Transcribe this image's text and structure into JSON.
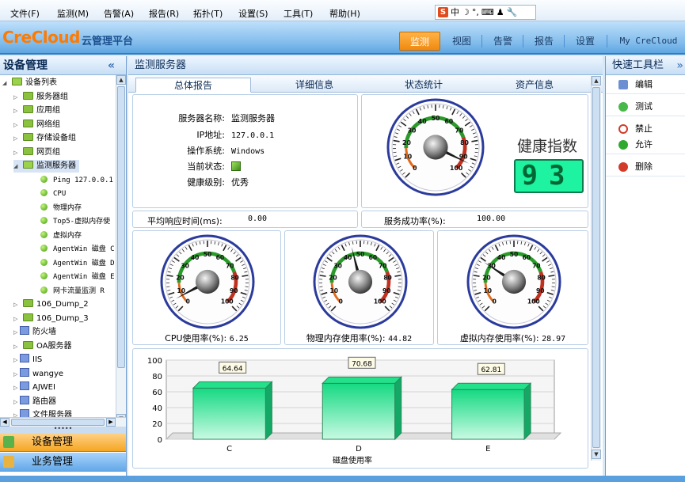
{
  "menubar": {
    "items": [
      "文件(F)",
      "监测(M)",
      "告警(A)",
      "报告(R)",
      "拓扑(T)",
      "设置(S)",
      "工具(T)",
      "帮助(H)"
    ],
    "ime": {
      "logo": "S",
      "mode": "中"
    }
  },
  "header": {
    "logo": "CreCloud",
    "logo_sub": "云管理平台",
    "tabs": [
      "监测",
      "视图",
      "告警",
      "报告",
      "设置"
    ],
    "active_tab": "监测",
    "user_link": "My CreCloud"
  },
  "left_panel": {
    "title": "设备管理",
    "collapse_icon": "double-chevron-left",
    "tree": [
      {
        "label": "设备列表",
        "level": 0,
        "expanded": true,
        "icon": "folder-open"
      },
      {
        "label": "服务器组",
        "level": 1,
        "icon": "folder"
      },
      {
        "label": "应用组",
        "level": 1,
        "icon": "folder"
      },
      {
        "label": "网络组",
        "level": 1,
        "icon": "folder"
      },
      {
        "label": "存储设备组",
        "level": 1,
        "icon": "folder"
      },
      {
        "label": "网页组",
        "level": 1,
        "icon": "folder"
      },
      {
        "label": "监测服务器",
        "level": 1,
        "expanded": true,
        "selected": true,
        "icon": "folder-open"
      },
      {
        "label": "Ping 127.0.0.1",
        "level": 2,
        "icon": "status-dot"
      },
      {
        "label": "CPU",
        "level": 2,
        "icon": "status-dot"
      },
      {
        "label": "物理内存",
        "level": 2,
        "icon": "status-dot"
      },
      {
        "label": "Top5-虚拟内存使",
        "level": 2,
        "icon": "status-dot"
      },
      {
        "label": "虚拟内存",
        "level": 2,
        "icon": "status-dot"
      },
      {
        "label": "AgentWin 磁盘 C",
        "level": 2,
        "icon": "status-dot"
      },
      {
        "label": "AgentWin 磁盘 D",
        "level": 2,
        "icon": "status-dot"
      },
      {
        "label": "AgentWin 磁盘 E",
        "level": 2,
        "icon": "status-dot"
      },
      {
        "label": "网卡流量监测 R",
        "level": 2,
        "icon": "status-dot"
      },
      {
        "label": "106_Dump_2",
        "level": 1,
        "icon": "folder"
      },
      {
        "label": "106_Dump_3",
        "level": 1,
        "icon": "folder"
      },
      {
        "label": "防火墙",
        "level": 1,
        "icon": "device"
      },
      {
        "label": "OA服务器",
        "level": 1,
        "icon": "folder"
      },
      {
        "label": "IIS",
        "level": 1,
        "icon": "device"
      },
      {
        "label": "wangye",
        "level": 1,
        "icon": "device"
      },
      {
        "label": "AJWEI",
        "level": 1,
        "icon": "device"
      },
      {
        "label": "路由器",
        "level": 1,
        "icon": "device"
      },
      {
        "label": "文件服务器",
        "level": 1,
        "icon": "device"
      }
    ],
    "accordion": [
      "设备管理",
      "业务管理"
    ]
  },
  "center": {
    "title": "监测服务器",
    "tabs": [
      "总体报告",
      "详细信息",
      "状态统计",
      "资产信息"
    ],
    "active_tab": "总体报告",
    "server_info": {
      "rows": [
        {
          "key": "服务器名称:",
          "value": "监测服务器"
        },
        {
          "key": "IP地址:",
          "value": "127.0.0.1"
        },
        {
          "key": "操作系统:",
          "value": "Windows"
        },
        {
          "key": "当前状态:",
          "value": ""
        },
        {
          "key": "健康级别:",
          "value": "优秀"
        }
      ]
    },
    "health": {
      "title": "健康指数",
      "value": "93",
      "gauge_value": 93
    },
    "avg_response": {
      "label": "平均响应时间(ms):",
      "value": "0.00"
    },
    "success_rate": {
      "label": "服务成功率(%):",
      "value": "100.00"
    },
    "gauges": [
      {
        "label": "CPU使用率(%):",
        "value": "6.25",
        "num": 6.25
      },
      {
        "label": "物理内存使用率(%):",
        "value": "44.82",
        "num": 44.82
      },
      {
        "label": "虚拟内存使用率(%):",
        "value": "28.97",
        "num": 28.97
      }
    ],
    "gauge_ticks": [
      "0",
      "10",
      "20",
      "30",
      "40",
      "50",
      "60",
      "70",
      "80",
      "90",
      "100"
    ]
  },
  "chart_data": {
    "type": "bar",
    "categories": [
      "C",
      "D",
      "E"
    ],
    "values": [
      64.64,
      70.68,
      62.81
    ],
    "data_labels": [
      "64.64",
      "70.68",
      "62.81"
    ],
    "xlabel": "磁盘使用率",
    "ylabel": "",
    "ylim": [
      0,
      100
    ],
    "yticks": [
      "0",
      "20",
      "40",
      "60",
      "80",
      "100"
    ],
    "grid": true,
    "bar_color": "#23e08a"
  },
  "right_panel": {
    "title": "快速工具栏",
    "tools": [
      {
        "label": "编辑",
        "icon": "edit-icon"
      },
      {
        "label": "测试",
        "icon": "test-icon"
      },
      {
        "label": "禁止",
        "icon": "forbid-icon"
      },
      {
        "label": "允许",
        "icon": "allow-icon"
      },
      {
        "label": "删除",
        "icon": "delete-icon"
      }
    ]
  },
  "colors": {
    "accent_orange": "#f08a10",
    "header_blue": "#5ea6e2",
    "gauge_green": "#2a9b2a",
    "gauge_red": "#c0301f",
    "lcd_green": "#1df3a1"
  }
}
